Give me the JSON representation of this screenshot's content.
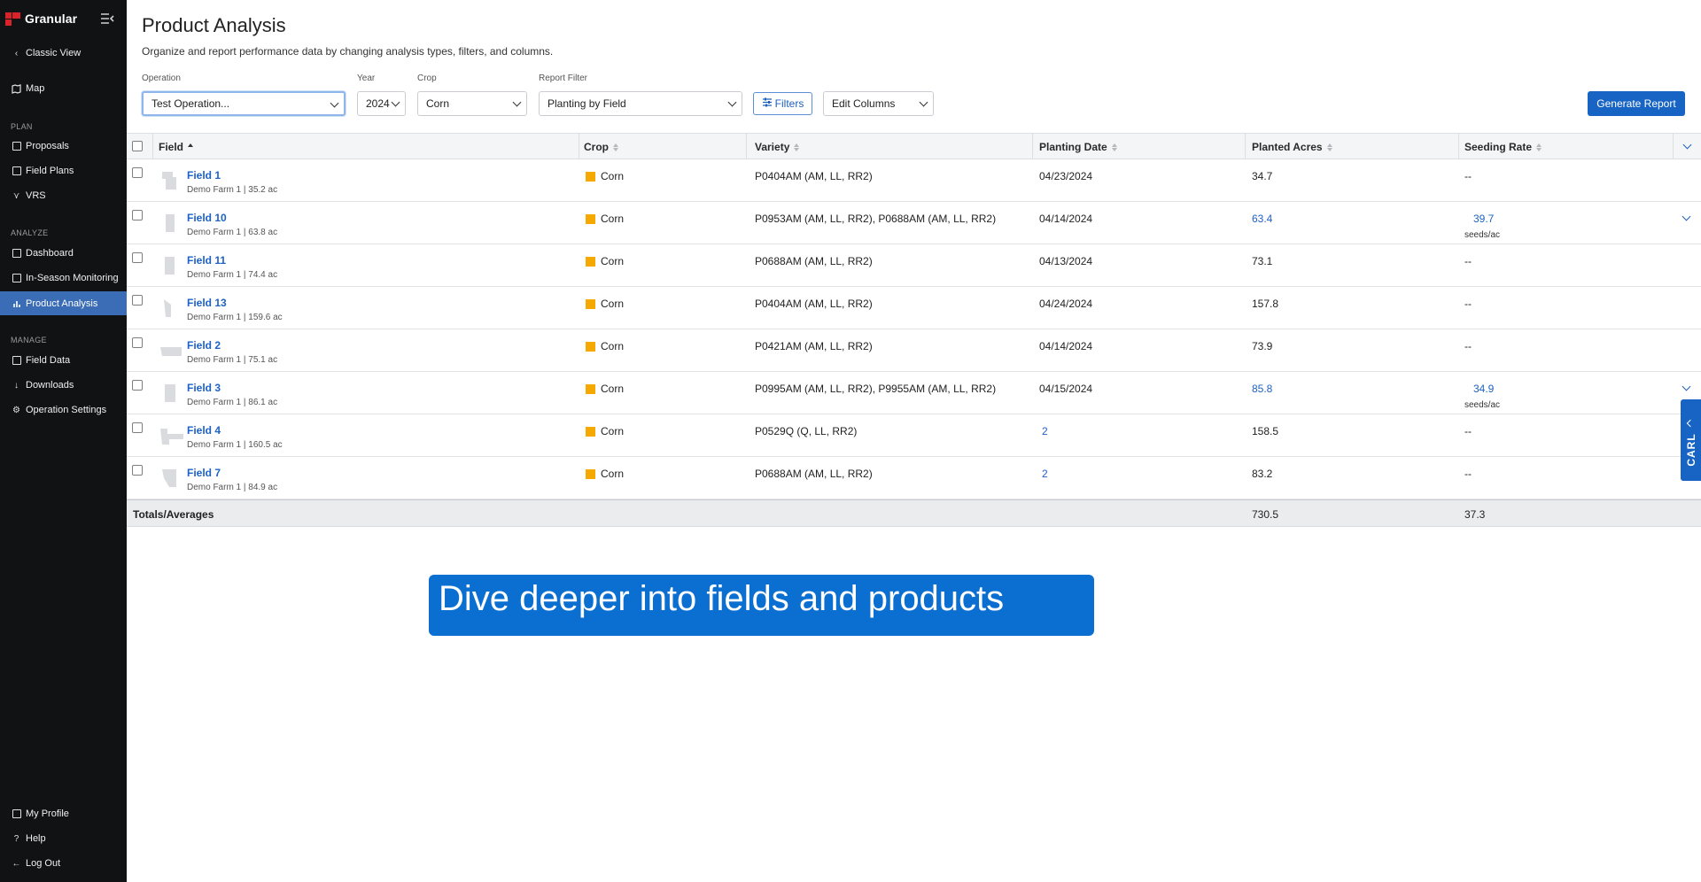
{
  "app": {
    "brand": "Granular"
  },
  "colors": {
    "sidebar_bg": "#111213",
    "active_nav": "#3a6db5",
    "accent": "#1764c4",
    "crop_corn": "#f5a800",
    "banner": "#0a6fd1"
  },
  "sidebar": {
    "classic_view": "Classic View",
    "map": "Map",
    "sections": {
      "plan": "PLAN",
      "analyze": "ANALYZE",
      "manage": "MANAGE"
    },
    "plan_items": [
      "Proposals",
      "Field Plans",
      "VRS"
    ],
    "analyze_items": [
      "Dashboard",
      "In-Season Monitoring",
      "Product Analysis"
    ],
    "manage_items": [
      "Field Data",
      "Downloads",
      "Operation Settings"
    ],
    "bottom_items": [
      "My Profile",
      "Help",
      "Log Out"
    ],
    "active": "Product Analysis"
  },
  "header": {
    "title": "Product Analysis",
    "subtitle": "Organize and report performance data by changing analysis types, filters, and columns."
  },
  "controls": {
    "operation": {
      "label": "Operation",
      "value": "Test Operation..."
    },
    "year": {
      "label": "Year",
      "value": "2024"
    },
    "crop": {
      "label": "Crop",
      "value": "Corn"
    },
    "report_filter": {
      "label": "Report Filter",
      "value": "Planting by Field"
    },
    "filters_label": "Filters",
    "edit_columns": "Edit Columns",
    "generate_report": "Generate Report"
  },
  "table": {
    "columns": [
      "Field",
      "Crop",
      "Variety",
      "Planting Date",
      "Planted Acres",
      "Seeding Rate"
    ],
    "rows": [
      {
        "field": "Field 1",
        "sub": "Demo Farm 1 | 35.2 ac",
        "crop": "Corn",
        "variety": "P0404AM (AM, LL, RR2)",
        "date": "04/23/2024",
        "acres": "34.7",
        "rate": "--"
      },
      {
        "field": "Field 10",
        "sub": "Demo Farm 1 | 63.8 ac",
        "crop": "Corn",
        "variety": "P0953AM (AM, LL, RR2), P0688AM (AM, LL, RR2)",
        "date": "04/14/2024",
        "acres": "63.4",
        "rate": "39.7",
        "rate_unit": "seeds/ac"
      },
      {
        "field": "Field 11",
        "sub": "Demo Farm 1 | 74.4 ac",
        "crop": "Corn",
        "variety": "P0688AM (AM, LL, RR2)",
        "date": "04/13/2024",
        "acres": "73.1",
        "rate": "--"
      },
      {
        "field": "Field 13",
        "sub": "Demo Farm 1 | 159.6 ac",
        "crop": "Corn",
        "variety": "P0404AM (AM, LL, RR2)",
        "date": "04/24/2024",
        "acres": "157.8",
        "rate": "--"
      },
      {
        "field": "Field 2",
        "sub": "Demo Farm 1 | 75.1 ac",
        "crop": "Corn",
        "variety": "P0421AM (AM, LL, RR2)",
        "date": "04/14/2024",
        "acres": "73.9",
        "rate": "--"
      },
      {
        "field": "Field 3",
        "sub": "Demo Farm 1 | 86.1 ac",
        "crop": "Corn",
        "variety": "P0995AM (AM, LL, RR2), P9955AM (AM, LL, RR2)",
        "date": "04/15/2024",
        "acres": "85.8",
        "rate": "34.9",
        "rate_unit": "seeds/ac"
      },
      {
        "field": "Field 4",
        "sub": "Demo Farm 1 | 160.5 ac",
        "crop": "Corn",
        "variety": "P0529Q (Q, LL, RR2)",
        "date": "2",
        "acres": "158.5",
        "rate": "--"
      },
      {
        "field": "Field 7",
        "sub": "Demo Farm 1 | 84.9 ac",
        "crop": "Corn",
        "variety": "P0688AM (AM, LL, RR2)",
        "date": "2",
        "acres": "83.2",
        "rate": "--"
      }
    ],
    "totals": {
      "label": "Totals/Averages",
      "acres": "730.5",
      "rate": "37.3"
    }
  },
  "carl_tab": "CARL",
  "banner": "Dive deeper into fields and products"
}
